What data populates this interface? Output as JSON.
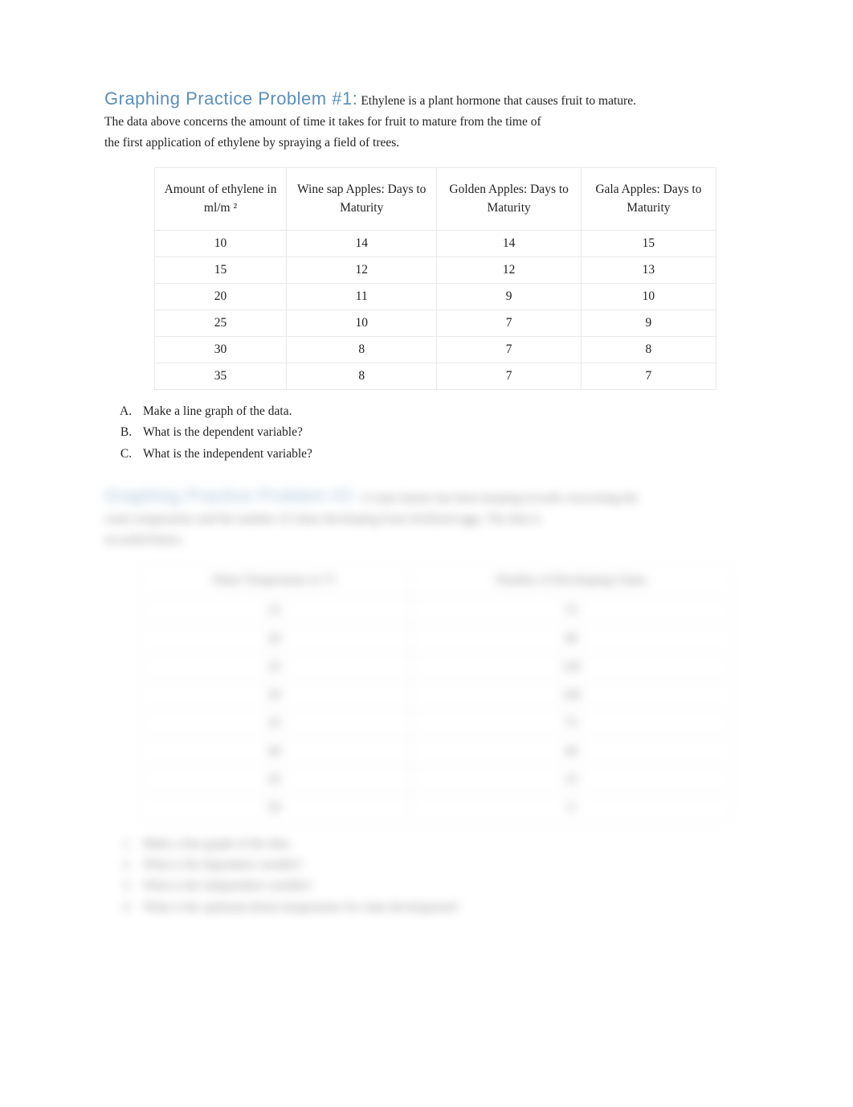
{
  "problem1": {
    "heading": "Graphing Practice Problem #1:",
    "intro_inline": "Ethylene is a plant hormone that causes fruit to mature.",
    "intro_line2": "The data above concerns the amount of time it takes for fruit to mature from the time of",
    "intro_line3": "the first application of ethylene by spraying a field of trees.",
    "table": {
      "headers": [
        "Amount of ethylene in ml/m ²",
        "Wine sap Apples: Days to Maturity",
        "Golden Apples: Days to Maturity",
        "Gala Apples: Days to Maturity"
      ],
      "rows": [
        [
          "10",
          "14",
          "14",
          "15"
        ],
        [
          "15",
          "12",
          "12",
          "13"
        ],
        [
          "20",
          "11",
          "9",
          "10"
        ],
        [
          "25",
          "10",
          "7",
          "9"
        ],
        [
          "30",
          "8",
          "7",
          "8"
        ],
        [
          "35",
          "8",
          "7",
          "7"
        ]
      ]
    },
    "questions": [
      "Make a line graph of the data.",
      "What is the dependent variable?",
      "What is the independent variable?"
    ]
  },
  "problem2": {
    "heading": "Graphing Practice Problem #2:",
    "intro_inline": "A clam farmer has been keeping records concerning the",
    "intro_line2": "water temperature and the number of clams developing from fertilized eggs. The data is",
    "intro_line3": "recorded below.",
    "table": {
      "headers": [
        "Water Temperature in °C",
        "Number of Developing Clams"
      ],
      "rows": [
        [
          "15",
          "75"
        ],
        [
          "20",
          "90"
        ],
        [
          "25",
          "120"
        ],
        [
          "30",
          "140"
        ],
        [
          "35",
          "75"
        ],
        [
          "40",
          "40"
        ],
        [
          "45",
          "15"
        ],
        [
          "50",
          "0"
        ]
      ]
    },
    "questions": [
      "Make a line graph of the data.",
      "What is the dependent variable?",
      "What is the independent variable?",
      "What is the optimum (best) temperature for clam development?"
    ]
  }
}
